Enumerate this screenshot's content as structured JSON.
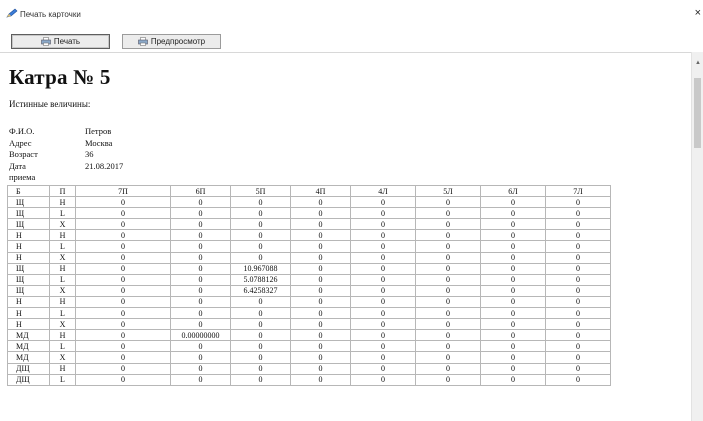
{
  "window": {
    "title": "Печать карточки",
    "close_glyph": "×"
  },
  "toolbar": {
    "print_label": "Печать",
    "preview_label": "Предпросмотр",
    "print_icon": "printer-icon",
    "preview_icon": "printer-icon"
  },
  "document": {
    "heading": "Катра № 5",
    "subtitle": "Истинные величины:",
    "info": [
      {
        "label": "Ф.И.О.",
        "value": "Петров"
      },
      {
        "label": "Адрес",
        "value": "Москва"
      },
      {
        "label": "Возраст",
        "value": "36"
      },
      {
        "label": "Дата приема",
        "value": "21.08.2017"
      }
    ],
    "table": {
      "headers": [
        "Б",
        "П",
        "7П",
        "6П",
        "5П",
        "4П",
        "4Л",
        "5Л",
        "6Л",
        "7Л"
      ],
      "rows": [
        [
          "Щ",
          "H",
          "0",
          "0",
          "0",
          "0",
          "0",
          "0",
          "0",
          "0"
        ],
        [
          "Щ",
          "L",
          "0",
          "0",
          "0",
          "0",
          "0",
          "0",
          "0",
          "0"
        ],
        [
          "Щ",
          "X",
          "0",
          "0",
          "0",
          "0",
          "0",
          "0",
          "0",
          "0"
        ],
        [
          "H",
          "H",
          "0",
          "0",
          "0",
          "0",
          "0",
          "0",
          "0",
          "0"
        ],
        [
          "H",
          "L",
          "0",
          "0",
          "0",
          "0",
          "0",
          "0",
          "0",
          "0"
        ],
        [
          "H",
          "X",
          "0",
          "0",
          "0",
          "0",
          "0",
          "0",
          "0",
          "0"
        ],
        [
          "Щ",
          "H",
          "0",
          "0",
          "10.967088",
          "0",
          "0",
          "0",
          "0",
          "0"
        ],
        [
          "Щ",
          "L",
          "0",
          "0",
          "5.0788126",
          "0",
          "0",
          "0",
          "0",
          "0"
        ],
        [
          "Щ",
          "X",
          "0",
          "0",
          "6.4258327",
          "0",
          "0",
          "0",
          "0",
          "0"
        ],
        [
          "H",
          "H",
          "0",
          "0",
          "0",
          "0",
          "0",
          "0",
          "0",
          "0"
        ],
        [
          "H",
          "L",
          "0",
          "0",
          "0",
          "0",
          "0",
          "0",
          "0",
          "0"
        ],
        [
          "H",
          "X",
          "0",
          "0",
          "0",
          "0",
          "0",
          "0",
          "0",
          "0"
        ],
        [
          "МД",
          "H",
          "0",
          "0.00000000",
          "0",
          "0",
          "0",
          "0",
          "0",
          "0"
        ],
        [
          "МД",
          "L",
          "0",
          "0",
          "0",
          "0",
          "0",
          "0",
          "0",
          "0"
        ],
        [
          "МД",
          "X",
          "0",
          "0",
          "0",
          "0",
          "0",
          "0",
          "0",
          "0"
        ],
        [
          "ДЩ",
          "H",
          "0",
          "0",
          "0",
          "0",
          "0",
          "0",
          "0",
          "0"
        ],
        [
          "ДЩ",
          "L",
          "0",
          "0",
          "0",
          "0",
          "0",
          "0",
          "0",
          "0"
        ]
      ]
    }
  },
  "colors": {
    "grid_border": "#b7b7b7",
    "button_bg": "#ececec"
  }
}
